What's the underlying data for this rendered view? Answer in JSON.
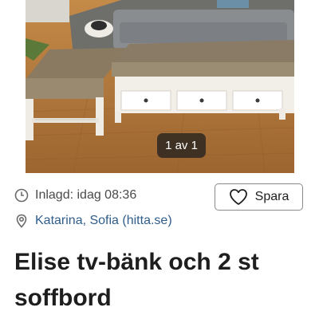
{
  "gallery": {
    "counter": "1 av 1"
  },
  "listing": {
    "posted_text": "Inlagd: idag 08:36",
    "location_text": "Katarina, Sofia (hitta.se)",
    "save_label": "Spara",
    "title": "Elise tv-bänk och 2 st soffbord"
  },
  "icons": {
    "posted": "clock-icon",
    "location": "location-pin-icon",
    "save": "heart-outline-icon"
  },
  "colors": {
    "link": "#2f5d8c",
    "title": "#1e1e1e",
    "counter_bg": "#28241f"
  }
}
